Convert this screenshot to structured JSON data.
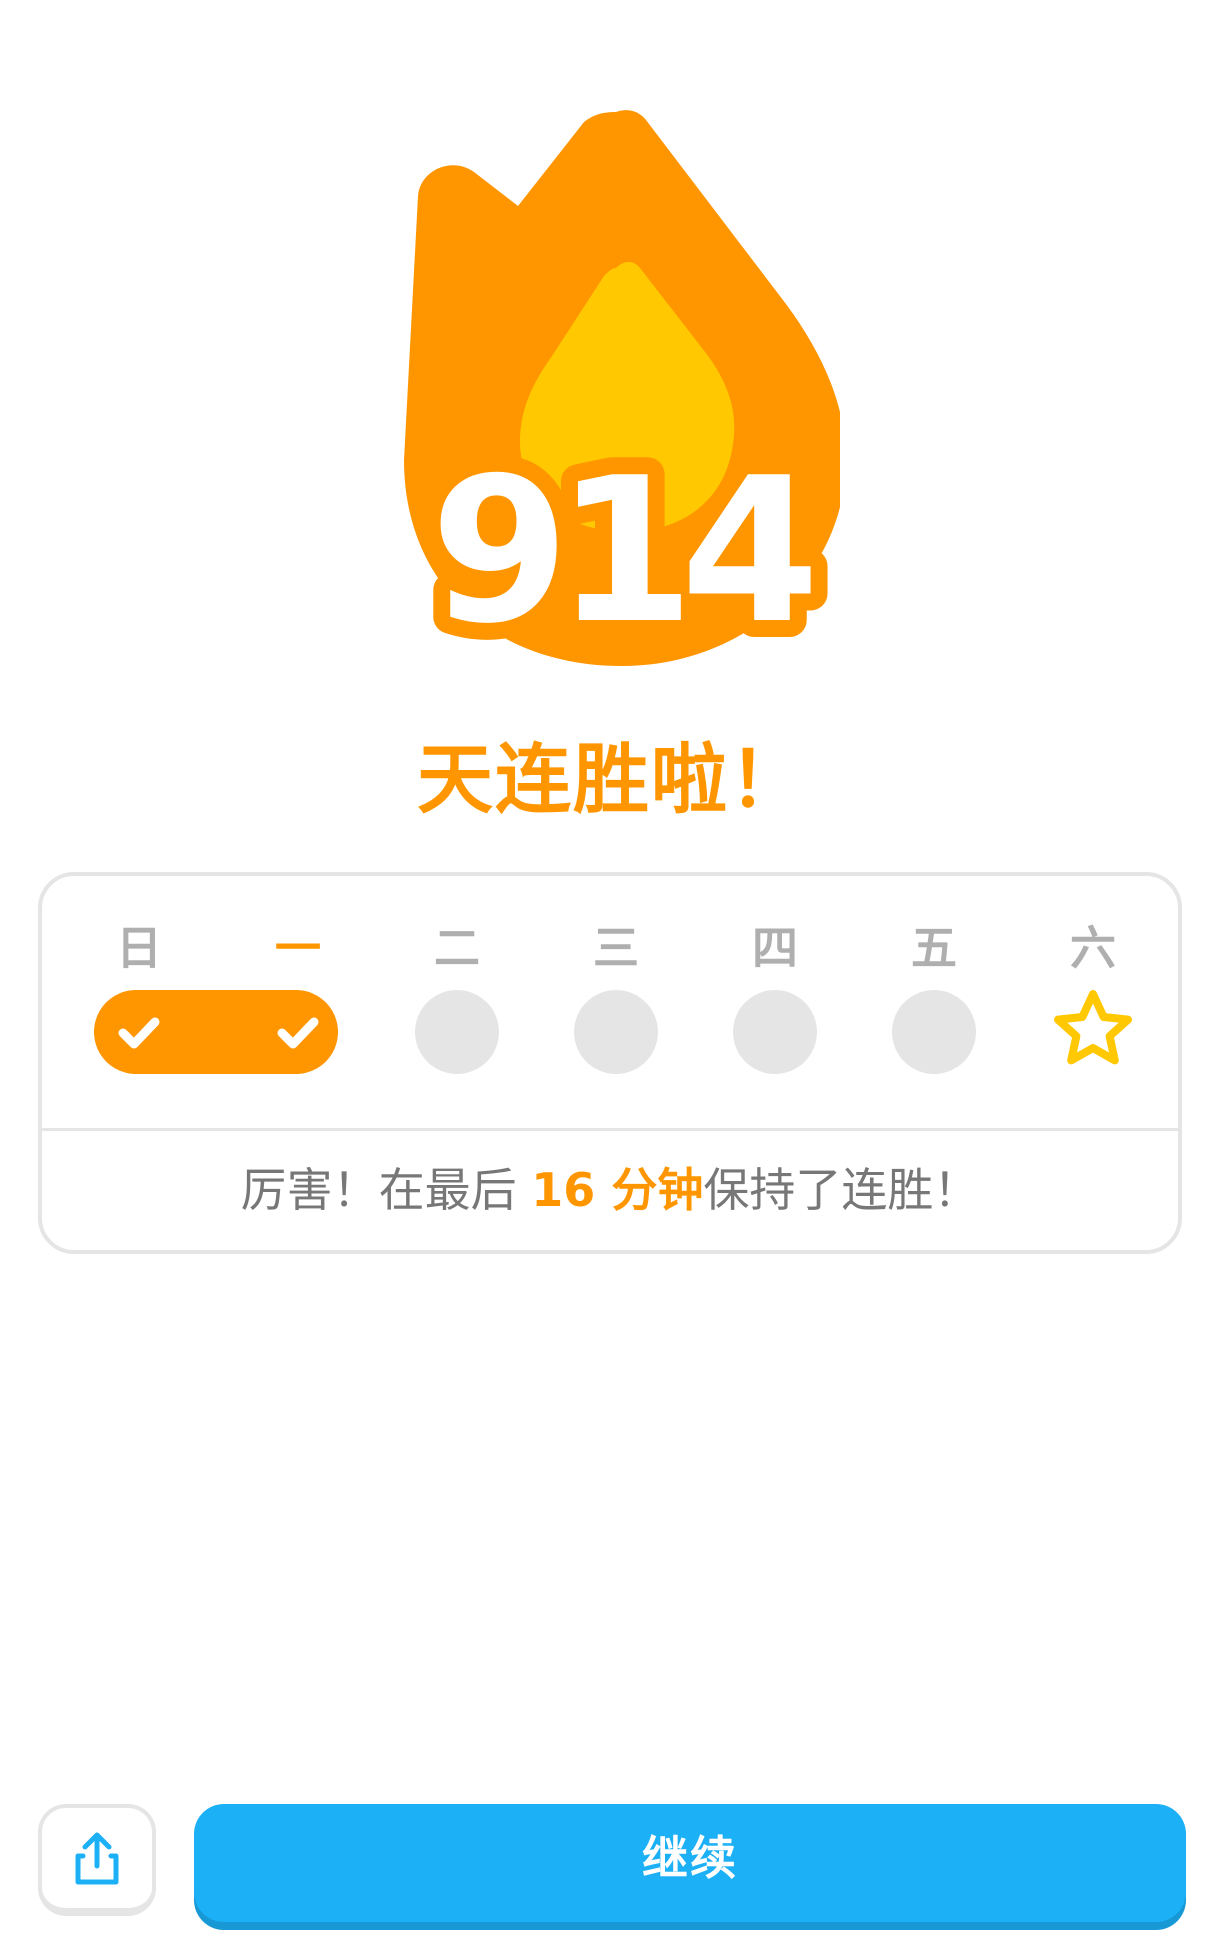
{
  "streak": {
    "count": "914",
    "headline": "天连胜啦！"
  },
  "week": {
    "days": [
      "日",
      "一",
      "二",
      "三",
      "四",
      "五",
      "六"
    ],
    "today_index": 1,
    "completed": [
      true,
      true,
      false,
      false,
      false,
      false,
      false
    ],
    "goal_day_icon": "star-icon"
  },
  "summary": {
    "prefix": "厉害！在最后 ",
    "highlight": "16 分钟",
    "suffix": "保持了连胜！"
  },
  "actions": {
    "share_icon": "share-icon",
    "continue_label": "继续"
  },
  "colors": {
    "orange": "#FF9600",
    "yellow": "#FFC800",
    "gray": "#E5E5E5",
    "blue": "#1CB0F6"
  }
}
